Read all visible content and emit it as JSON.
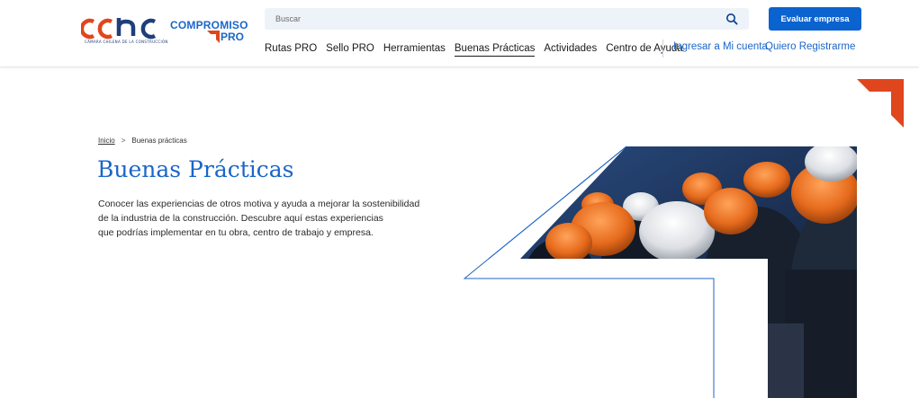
{
  "header": {
    "logo_sub": "CÁMARA CHILENA DE LA CONSTRUCCIÓN",
    "logo_program": "COMPROMISO",
    "logo_program_suffix": "PRO",
    "search_placeholder": "Buscar",
    "evaluate_button": "Evaluar empresa",
    "nav": [
      {
        "label": "Rutas PRO",
        "active": false
      },
      {
        "label": "Sello PRO",
        "active": false
      },
      {
        "label": "Herramientas",
        "active": false
      },
      {
        "label": "Buenas Prácticas",
        "active": true
      },
      {
        "label": "Actividades",
        "active": false
      },
      {
        "label": "Centro de Ayuda",
        "active": false
      }
    ],
    "login_link": "Ingresar a Mi cuenta",
    "register_link": "Quiero Registrarme"
  },
  "breadcrumb": {
    "home": "Inicio",
    "separator": ">",
    "current": "Buenas prácticas"
  },
  "page": {
    "title": "Buenas Prácticas",
    "intro_lines": [
      "Conocer las experiencias de otros motiva y ayuda a mejorar la sostenibilidad",
      "de la industria de la construcción. Descubre aquí estas experiencias",
      "que podrías implementar en tu obra, centro de trabajo y empresa."
    ]
  },
  "colors": {
    "brand_blue": "#1a66c9",
    "button_blue": "#0b63cf",
    "accent_orange": "#e0461e",
    "search_bg": "#eef3fa"
  },
  "icons": {
    "search": "search-icon",
    "logo": "cchc-logo",
    "corner": "corner-accent-icon"
  }
}
